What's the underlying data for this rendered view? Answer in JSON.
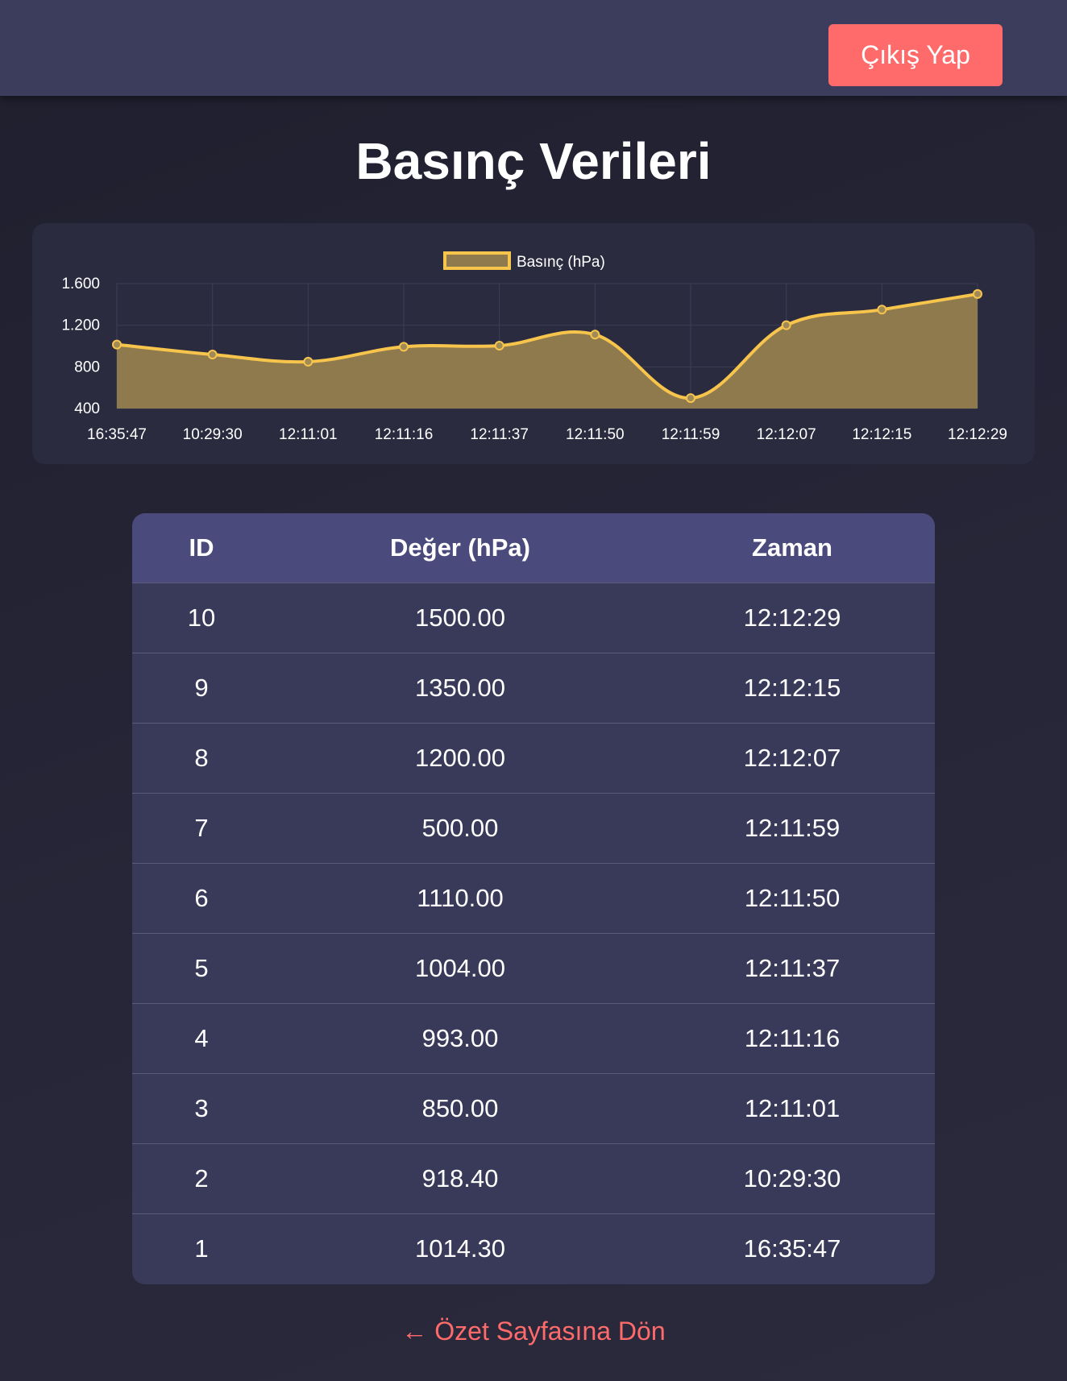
{
  "header": {
    "logout_label": "Çıkış Yap"
  },
  "page": {
    "title": "Basınç Verileri"
  },
  "colors": {
    "accent": "#ff6b6b",
    "line": "#f7c44c",
    "fill": "#8f7a4d",
    "header_bg": "#3c3c5c",
    "table_head_bg": "#4a4a7c"
  },
  "chart_data": {
    "type": "line",
    "title": "",
    "xlabel": "",
    "ylabel": "",
    "x": [
      "16:35:47",
      "10:29:30",
      "12:11:01",
      "12:11:16",
      "12:11:37",
      "12:11:50",
      "12:11:59",
      "12:12:07",
      "12:12:15",
      "12:12:29"
    ],
    "series": [
      {
        "name": "Basınç (hPa)",
        "values": [
          1014.3,
          918.4,
          850,
          993,
          1004,
          1110,
          500,
          1200,
          1350,
          1500
        ],
        "fill": true,
        "smooth": true
      }
    ],
    "ylim": [
      400,
      1600
    ],
    "yticks": [
      "1.600",
      "1.200",
      "800",
      "400"
    ],
    "ytick_values": [
      1600,
      1200,
      800,
      400
    ],
    "grid": true,
    "legend": "top-center"
  },
  "table": {
    "headers": [
      "ID",
      "Değer (hPa)",
      "Zaman"
    ],
    "rows": [
      [
        "10",
        "1500.00",
        "12:12:29"
      ],
      [
        "9",
        "1350.00",
        "12:12:15"
      ],
      [
        "8",
        "1200.00",
        "12:12:07"
      ],
      [
        "7",
        "500.00",
        "12:11:59"
      ],
      [
        "6",
        "1110.00",
        "12:11:50"
      ],
      [
        "5",
        "1004.00",
        "12:11:37"
      ],
      [
        "4",
        "993.00",
        "12:11:16"
      ],
      [
        "3",
        "850.00",
        "12:11:01"
      ],
      [
        "2",
        "918.40",
        "10:29:30"
      ],
      [
        "1",
        "1014.30",
        "16:35:47"
      ]
    ]
  },
  "footer": {
    "back_label": "← Özet Sayfasına Dön"
  }
}
